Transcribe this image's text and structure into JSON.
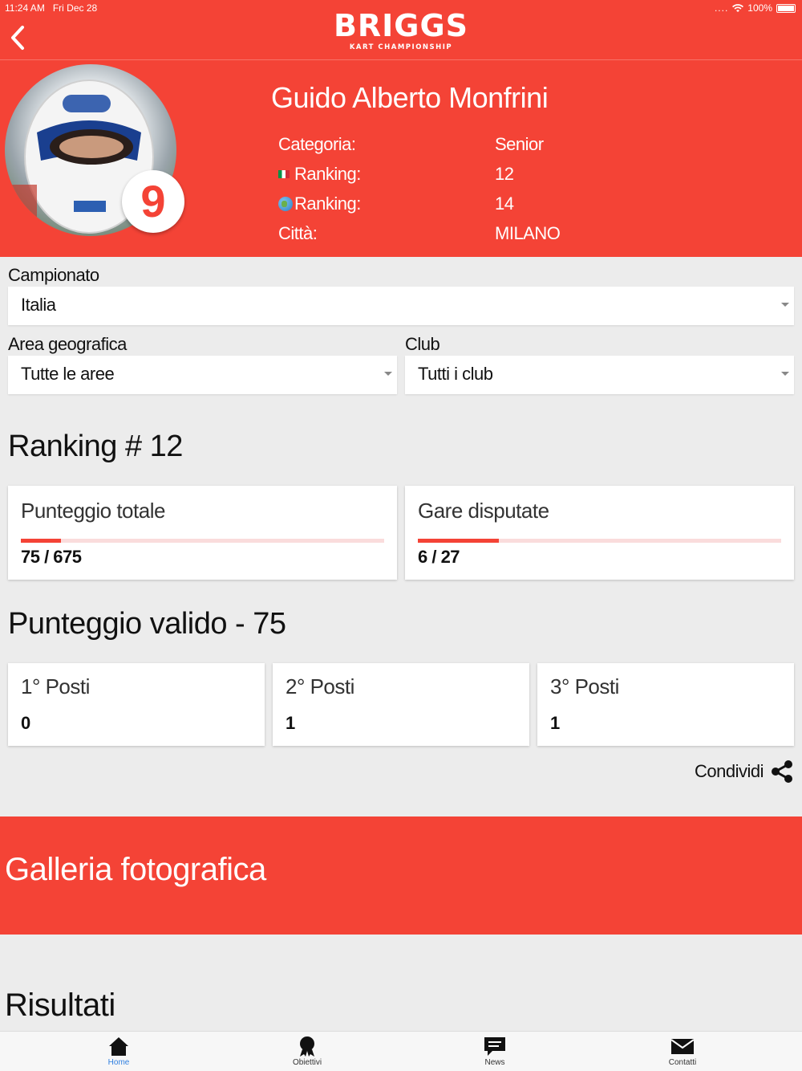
{
  "status_bar": {
    "time": "11:24 AM",
    "date": "Fri Dec 28",
    "battery": "100%"
  },
  "nav": {
    "logo_main": "BRIGGS",
    "logo_sub": "KART CHAMPIONSHIP"
  },
  "driver": {
    "name": "Guido Alberto Monfrini",
    "number": "9",
    "fields": [
      {
        "label": "Categoria:",
        "value": "Senior"
      },
      {
        "label": "Ranking:",
        "value": "12"
      },
      {
        "label": "Ranking:",
        "value": "14"
      },
      {
        "label": "Città:",
        "value": "MILANO"
      }
    ]
  },
  "filters": {
    "championship_label": "Campionato",
    "championship_value": "Italia",
    "area_label": "Area geografica",
    "area_value": "Tutte le aree",
    "club_label": "Club",
    "club_value": "Tutti i club"
  },
  "ranking": {
    "heading": "Ranking # 12",
    "score_title": "Punteggio totale",
    "score_value": "75 / 675",
    "score_fraction": 0.111,
    "races_title": "Gare disputate",
    "races_value": "6 / 27",
    "races_fraction": 0.222
  },
  "valid_score": {
    "heading": "Punteggio valido - 75",
    "places": [
      {
        "title": "1° Posti",
        "value": "0"
      },
      {
        "title": "2° Posti",
        "value": "1"
      },
      {
        "title": "3° Posti",
        "value": "1"
      }
    ]
  },
  "share_label": "Condividi",
  "gallery_title": "Galleria fotografica",
  "results_title": "Risultati",
  "tabs": [
    {
      "label": "Home",
      "icon": "home-icon",
      "active": true
    },
    {
      "label": "Obiettivi",
      "icon": "award-icon",
      "active": false
    },
    {
      "label": "News",
      "icon": "chat-icon",
      "active": false
    },
    {
      "label": "Contatti",
      "icon": "mail-icon",
      "active": false
    }
  ],
  "colors": {
    "accent": "#f44336",
    "tab_active": "#2f7fe0"
  }
}
